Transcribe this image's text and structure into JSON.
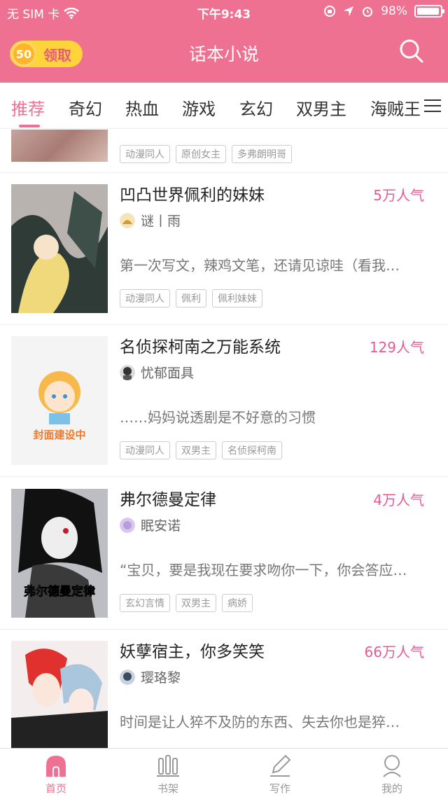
{
  "status_bar": {
    "carrier": "无 SIM 卡",
    "time": "下午9:43",
    "battery": "98%",
    "battery_level": 0.98
  },
  "header": {
    "coin_value": "50",
    "coin_label": "领取",
    "title": "话本小说"
  },
  "tabs": [
    {
      "label": "推荐",
      "active": true
    },
    {
      "label": "奇幻"
    },
    {
      "label": "热血"
    },
    {
      "label": "游戏"
    },
    {
      "label": "玄幻"
    },
    {
      "label": "双男主"
    },
    {
      "label": "海贼王"
    }
  ],
  "partial_card": {
    "tags": [
      "动漫同人",
      "原创女主",
      "多弗朗明哥"
    ]
  },
  "books": [
    {
      "title": "凹凸世界佩利的妹妹",
      "popularity": "5万人气",
      "author": "谜丨雨",
      "summary": "第一次写文，辣鸡文笔，还请见谅哇（看我…",
      "tags": [
        "动漫同人",
        "佩利",
        "佩利妹妹"
      ]
    },
    {
      "title": "名侦探柯南之万能系统",
      "popularity": "129人气",
      "author": "忧郁面具",
      "summary": "……妈妈说透剧是不好意的习惯",
      "tags": [
        "动漫同人",
        "双男主",
        "名侦探柯南"
      ],
      "cover_text": "封面建设中"
    },
    {
      "title": "弗尔德曼定律",
      "popularity": "4万人气",
      "author": "眠安诺",
      "summary": "“宝贝，要是我现在要求吻你一下，你会答应…",
      "tags": [
        "玄幻言情",
        "双男主",
        "病娇"
      ],
      "cover_text": "弗尔德曼定律"
    },
    {
      "title": "妖孽宿主，你多笑笑",
      "popularity": "66万人气",
      "author": "璎珞黎",
      "summary": "时间是让人猝不及防的东西、失去你也是猝…",
      "tags": []
    }
  ],
  "bottom_nav": [
    {
      "label": "首页",
      "active": true
    },
    {
      "label": "书架"
    },
    {
      "label": "写作"
    },
    {
      "label": "我的"
    }
  ]
}
